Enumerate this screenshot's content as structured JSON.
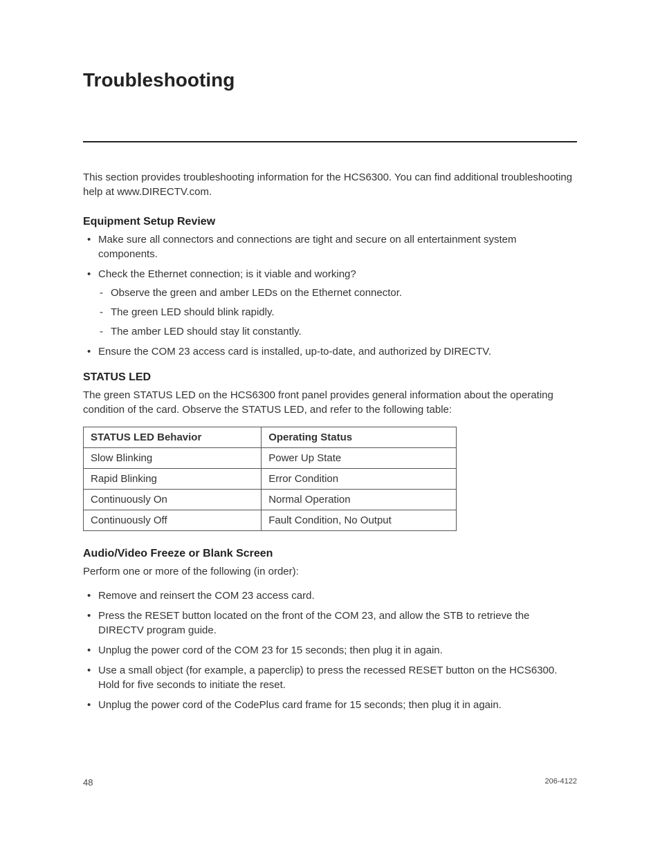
{
  "title": "Troubleshooting",
  "intro": "This section provides troubleshooting information for the HCS6300. You can find additional troubleshooting help at www.DIRECTV.com.",
  "sections": {
    "equipment": {
      "heading": "Equipment Setup Review",
      "bullets": [
        "Make sure all connectors and connections are tight and secure on all entertainment system components.",
        "Check the Ethernet connection; is it viable and working?",
        "Ensure the COM 23 access card is installed, up-to-date, and authorized by DIRECTV."
      ],
      "ethernet_sub": [
        "Observe the green and amber LEDs on the Ethernet connector.",
        "The green LED should blink rapidly.",
        "The amber LED should stay lit constantly."
      ]
    },
    "status_led": {
      "heading": "STATUS LED",
      "intro": "The green STATUS LED on the HCS6300 front panel provides general information about the operating condition of the card. Observe the STATUS LED, and refer to the following table:",
      "table": {
        "headers": [
          "STATUS LED Behavior",
          "Operating Status"
        ],
        "rows": [
          [
            "Slow Blinking",
            "Power Up State"
          ],
          [
            "Rapid Blinking",
            "Error Condition"
          ],
          [
            "Continuously On",
            "Normal Operation"
          ],
          [
            "Continuously Off",
            "Fault Condition, No Output"
          ]
        ]
      }
    },
    "av_freeze": {
      "heading": "Audio/Video Freeze or Blank Screen",
      "intro": "Perform one or more of the following (in order):",
      "bullets": [
        "Remove and reinsert the COM 23 access card.",
        "Press the RESET button located on the front of the COM 23, and allow the STB to retrieve the DIRECTV program guide.",
        "Unplug the power cord of the COM 23 for 15 seconds; then plug it in again.",
        "Use a small object (for example, a paperclip) to press the recessed RESET button on the HCS6300. Hold for five seconds to initiate the reset.",
        "Unplug the power cord of the CodePlus card frame for 15 seconds; then plug it in again."
      ]
    }
  },
  "footer": {
    "page": "48",
    "docnum": "206-4122"
  }
}
